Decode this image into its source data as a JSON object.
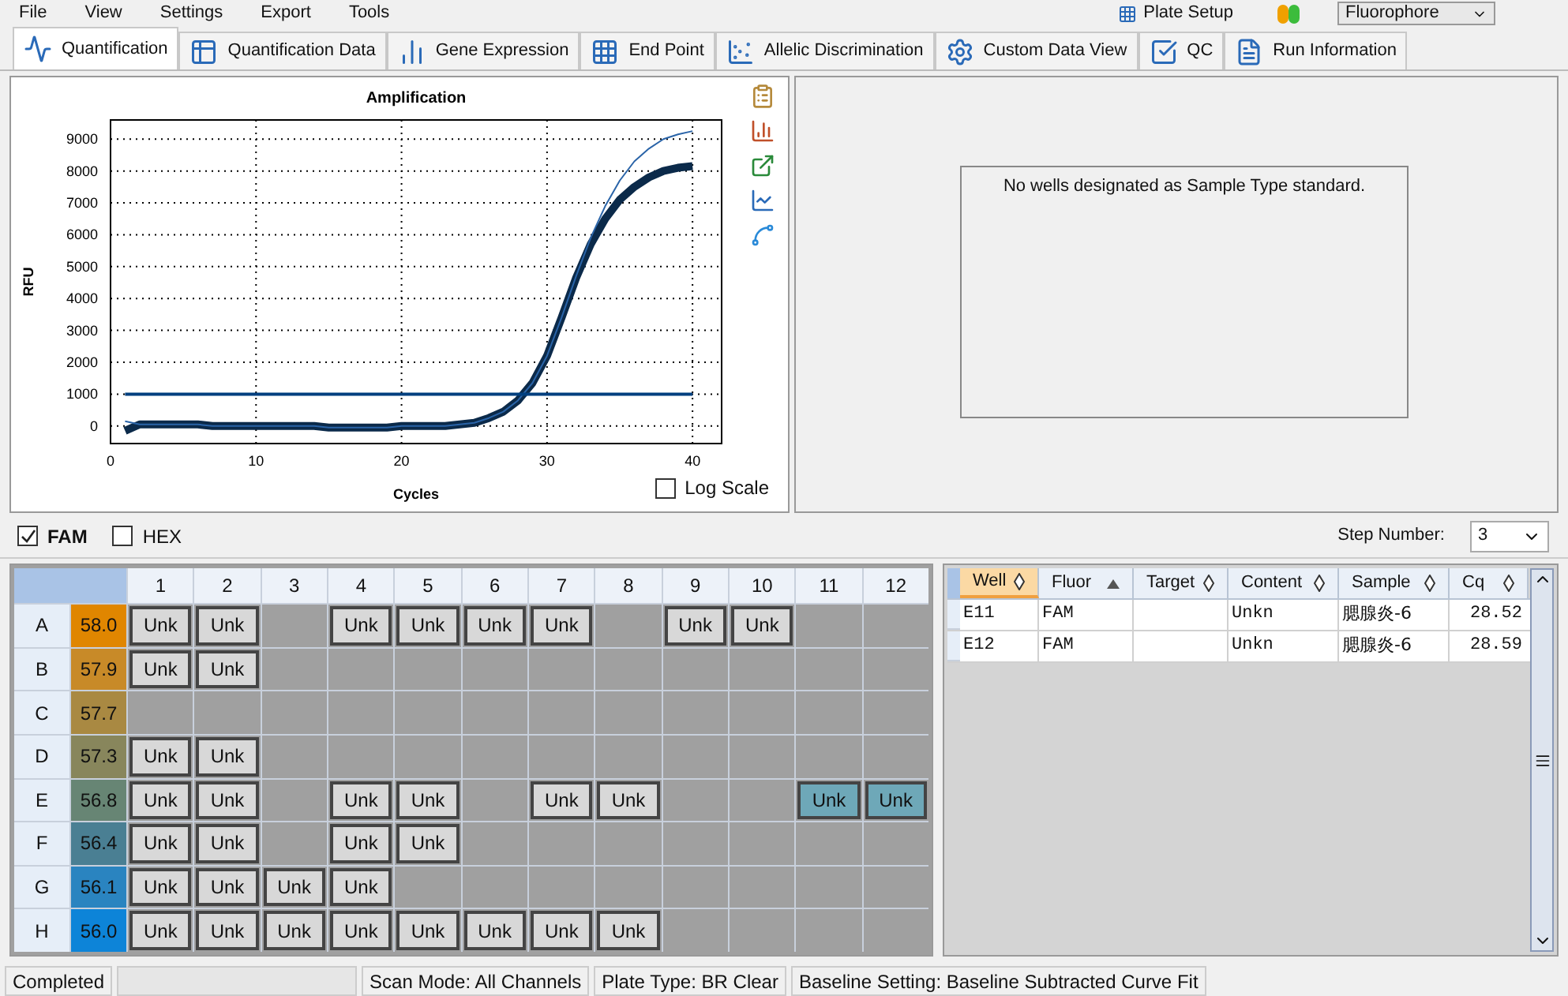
{
  "menu": {
    "items": [
      "File",
      "View",
      "Settings",
      "Export",
      "Tools"
    ],
    "plate_setup": "Plate Setup",
    "fluorophore": "Fluorophore"
  },
  "tabs": [
    {
      "label": "Quantification",
      "selected": true
    },
    {
      "label": "Quantification Data",
      "selected": false
    },
    {
      "label": "Gene Expression",
      "selected": false
    },
    {
      "label": "End Point",
      "selected": false
    },
    {
      "label": "Allelic Discrimination",
      "selected": false
    },
    {
      "label": "Custom Data View",
      "selected": false
    },
    {
      "label": "QC",
      "selected": false
    },
    {
      "label": "Run Information",
      "selected": false
    }
  ],
  "chart": {
    "log_scale": {
      "label": "Log Scale",
      "checked": false
    },
    "chart_data": {
      "type": "line",
      "title": "Amplification",
      "xlabel": "Cycles",
      "ylabel": "RFU",
      "grid": true,
      "xlim": [
        0,
        42
      ],
      "ylim": [
        -550,
        9600
      ],
      "xticks": [
        0,
        10,
        20,
        30,
        40
      ],
      "yticks": [
        0,
        1000,
        2000,
        3000,
        4000,
        5000,
        6000,
        7000,
        8000,
        9000
      ],
      "x": [
        1,
        2,
        3,
        4,
        5,
        6,
        7,
        8,
        9,
        10,
        11,
        12,
        13,
        14,
        15,
        16,
        17,
        18,
        19,
        20,
        21,
        22,
        23,
        24,
        25,
        26,
        27,
        28,
        29,
        30,
        31,
        32,
        33,
        34,
        35,
        36,
        37,
        38,
        39,
        40
      ],
      "series": [
        {
          "color": "#0b2a4a",
          "values": [
            -150,
            50,
            50,
            50,
            50,
            50,
            0,
            0,
            0,
            0,
            0,
            0,
            0,
            0,
            -50,
            -50,
            -50,
            -50,
            -50,
            0,
            0,
            0,
            0,
            50,
            100,
            250,
            450,
            800,
            1350,
            2200,
            3400,
            4650,
            5700,
            6500,
            7100,
            7500,
            7800,
            8000,
            8100,
            8150
          ]
        },
        {
          "color": "#2a64a8",
          "values": [
            150,
            50,
            50,
            50,
            50,
            50,
            0,
            0,
            0,
            0,
            0,
            0,
            0,
            0,
            -50,
            -50,
            -50,
            -50,
            -50,
            0,
            0,
            0,
            0,
            50,
            100,
            250,
            450,
            800,
            1350,
            2200,
            3400,
            4700,
            5900,
            6900,
            7700,
            8300,
            8700,
            9000,
            9150,
            9250
          ]
        },
        {
          "color": "#003f7f",
          "values": [
            1000,
            1000,
            1000,
            1000,
            1000,
            1000,
            1000,
            1000,
            1000,
            1000,
            1000,
            1000,
            1000,
            1000,
            1000,
            1000,
            1000,
            1000,
            1000,
            1000,
            1000,
            1000,
            1000,
            1000,
            1000,
            1000,
            1000,
            1000,
            1000,
            1000,
            1000,
            1000,
            1000,
            1000,
            1000,
            1000,
            1000,
            1000,
            1000,
            1000
          ]
        }
      ]
    }
  },
  "standard_curve": {
    "message": "No wells designated as Sample Type standard."
  },
  "fluors": [
    {
      "label": "FAM",
      "checked": true
    },
    {
      "label": "HEX",
      "checked": false
    }
  ],
  "step_number": {
    "label": "Step Number:",
    "value": "3"
  },
  "plate": {
    "columns": [
      "1",
      "2",
      "3",
      "4",
      "5",
      "6",
      "7",
      "8",
      "9",
      "10",
      "11",
      "12"
    ],
    "rows": [
      {
        "label": "A",
        "temp": "58.0",
        "color": "#e08600",
        "wells": [
          {
            "kind": "sample",
            "content": "Unk",
            "selected": false
          },
          {
            "kind": "sample",
            "content": "Unk",
            "selected": false
          },
          {
            "kind": "empty",
            "selected": false
          },
          {
            "kind": "sample",
            "content": "Unk",
            "selected": false
          },
          {
            "kind": "sample",
            "content": "Unk",
            "selected": false
          },
          {
            "kind": "sample",
            "content": "Unk",
            "selected": false
          },
          {
            "kind": "sample",
            "content": "Unk",
            "selected": false
          },
          {
            "kind": "empty",
            "selected": false
          },
          {
            "kind": "sample",
            "content": "Unk",
            "selected": false
          },
          {
            "kind": "sample",
            "content": "Unk",
            "selected": false
          },
          {
            "kind": "empty",
            "selected": false
          },
          {
            "kind": "empty",
            "selected": false
          }
        ]
      },
      {
        "label": "B",
        "temp": "57.9",
        "color": "#c88a28",
        "wells": [
          {
            "kind": "sample",
            "content": "Unk",
            "selected": false
          },
          {
            "kind": "sample",
            "content": "Unk",
            "selected": false
          },
          {
            "kind": "empty",
            "selected": false
          },
          {
            "kind": "empty",
            "selected": false
          },
          {
            "kind": "empty",
            "selected": false
          },
          {
            "kind": "empty",
            "selected": false
          },
          {
            "kind": "empty",
            "selected": false
          },
          {
            "kind": "empty",
            "selected": false
          },
          {
            "kind": "empty",
            "selected": false
          },
          {
            "kind": "empty",
            "selected": false
          },
          {
            "kind": "empty",
            "selected": false
          },
          {
            "kind": "empty",
            "selected": false
          }
        ]
      },
      {
        "label": "C",
        "temp": "57.7",
        "color": "#a98942",
        "wells": [
          {
            "kind": "empty",
            "selected": false
          },
          {
            "kind": "empty",
            "selected": false
          },
          {
            "kind": "empty",
            "selected": false
          },
          {
            "kind": "empty",
            "selected": false
          },
          {
            "kind": "empty",
            "selected": false
          },
          {
            "kind": "empty",
            "selected": false
          },
          {
            "kind": "empty",
            "selected": false
          },
          {
            "kind": "empty",
            "selected": false
          },
          {
            "kind": "empty",
            "selected": false
          },
          {
            "kind": "empty",
            "selected": false
          },
          {
            "kind": "empty",
            "selected": false
          },
          {
            "kind": "empty",
            "selected": false
          }
        ]
      },
      {
        "label": "D",
        "temp": "57.3",
        "color": "#88865c",
        "wells": [
          {
            "kind": "sample",
            "content": "Unk",
            "selected": false
          },
          {
            "kind": "sample",
            "content": "Unk",
            "selected": false
          },
          {
            "kind": "empty",
            "selected": false
          },
          {
            "kind": "empty",
            "selected": false
          },
          {
            "kind": "empty",
            "selected": false
          },
          {
            "kind": "empty",
            "selected": false
          },
          {
            "kind": "empty",
            "selected": false
          },
          {
            "kind": "empty",
            "selected": false
          },
          {
            "kind": "empty",
            "selected": false
          },
          {
            "kind": "empty",
            "selected": false
          },
          {
            "kind": "empty",
            "selected": false
          },
          {
            "kind": "empty",
            "selected": false
          }
        ]
      },
      {
        "label": "E",
        "temp": "56.8",
        "color": "#678574",
        "wells": [
          {
            "kind": "sample",
            "content": "Unk",
            "selected": false
          },
          {
            "kind": "sample",
            "content": "Unk",
            "selected": false
          },
          {
            "kind": "empty",
            "selected": false
          },
          {
            "kind": "sample",
            "content": "Unk",
            "selected": false
          },
          {
            "kind": "sample",
            "content": "Unk",
            "selected": false
          },
          {
            "kind": "empty",
            "selected": false
          },
          {
            "kind": "sample",
            "content": "Unk",
            "selected": false
          },
          {
            "kind": "sample",
            "content": "Unk",
            "selected": false
          },
          {
            "kind": "empty",
            "selected": false
          },
          {
            "kind": "empty",
            "selected": false
          },
          {
            "kind": "sample",
            "content": "Unk",
            "selected": true
          },
          {
            "kind": "sample",
            "content": "Unk",
            "selected": true
          }
        ]
      },
      {
        "label": "F",
        "temp": "56.4",
        "color": "#4a7f93",
        "wells": [
          {
            "kind": "sample",
            "content": "Unk",
            "selected": false
          },
          {
            "kind": "sample",
            "content": "Unk",
            "selected": false
          },
          {
            "kind": "empty",
            "selected": false
          },
          {
            "kind": "sample",
            "content": "Unk",
            "selected": false
          },
          {
            "kind": "sample",
            "content": "Unk",
            "selected": false
          },
          {
            "kind": "empty",
            "selected": false
          },
          {
            "kind": "empty",
            "selected": false
          },
          {
            "kind": "empty",
            "selected": false
          },
          {
            "kind": "empty",
            "selected": false
          },
          {
            "kind": "empty",
            "selected": false
          },
          {
            "kind": "empty",
            "selected": false
          },
          {
            "kind": "empty",
            "selected": false
          }
        ]
      },
      {
        "label": "G",
        "temp": "56.1",
        "color": "#2a84c0",
        "wells": [
          {
            "kind": "sample",
            "content": "Unk",
            "selected": false
          },
          {
            "kind": "sample",
            "content": "Unk",
            "selected": false
          },
          {
            "kind": "sample",
            "content": "Unk",
            "selected": false
          },
          {
            "kind": "sample",
            "content": "Unk",
            "selected": false
          },
          {
            "kind": "empty",
            "selected": false
          },
          {
            "kind": "empty",
            "selected": false
          },
          {
            "kind": "empty",
            "selected": false
          },
          {
            "kind": "empty",
            "selected": false
          },
          {
            "kind": "empty",
            "selected": false
          },
          {
            "kind": "empty",
            "selected": false
          },
          {
            "kind": "empty",
            "selected": false
          },
          {
            "kind": "empty",
            "selected": false
          }
        ]
      },
      {
        "label": "H",
        "temp": "56.0",
        "color": "#0d84d8",
        "wells": [
          {
            "kind": "sample",
            "content": "Unk",
            "selected": false
          },
          {
            "kind": "sample",
            "content": "Unk",
            "selected": false
          },
          {
            "kind": "sample",
            "content": "Unk",
            "selected": false
          },
          {
            "kind": "sample",
            "content": "Unk",
            "selected": false
          },
          {
            "kind": "sample",
            "content": "Unk",
            "selected": false
          },
          {
            "kind": "sample",
            "content": "Unk",
            "selected": false
          },
          {
            "kind": "sample",
            "content": "Unk",
            "selected": false
          },
          {
            "kind": "sample",
            "content": "Unk",
            "selected": false
          },
          {
            "kind": "empty",
            "selected": false
          },
          {
            "kind": "empty",
            "selected": false
          },
          {
            "kind": "empty",
            "selected": false
          },
          {
            "kind": "empty",
            "selected": false
          }
        ]
      }
    ]
  },
  "results": {
    "columns": [
      {
        "label": "Well",
        "selected": true,
        "sorted_ascending": false
      },
      {
        "label": "Fluor",
        "selected": false,
        "sorted_ascending": true
      },
      {
        "label": "Target",
        "selected": false,
        "sorted_ascending": false
      },
      {
        "label": "Content",
        "selected": false,
        "sorted_ascending": false
      },
      {
        "label": "Sample",
        "selected": false,
        "sorted_ascending": false
      },
      {
        "label": "Cq",
        "selected": false,
        "sorted_ascending": false
      }
    ],
    "rows": [
      {
        "well": "E11",
        "fluor": "FAM",
        "content": "Unkn",
        "sample": "腮腺炎-6",
        "cq": "28.52"
      },
      {
        "well": "E12",
        "fluor": "FAM",
        "content": "Unkn",
        "sample": "腮腺炎-6",
        "cq": "28.59"
      }
    ]
  },
  "status_bar": {
    "state": "Completed",
    "fields": [
      "Scan Mode: All Channels",
      "Plate Type: BR Clear",
      "Baseline Setting: Baseline Subtracted Curve Fit"
    ]
  }
}
